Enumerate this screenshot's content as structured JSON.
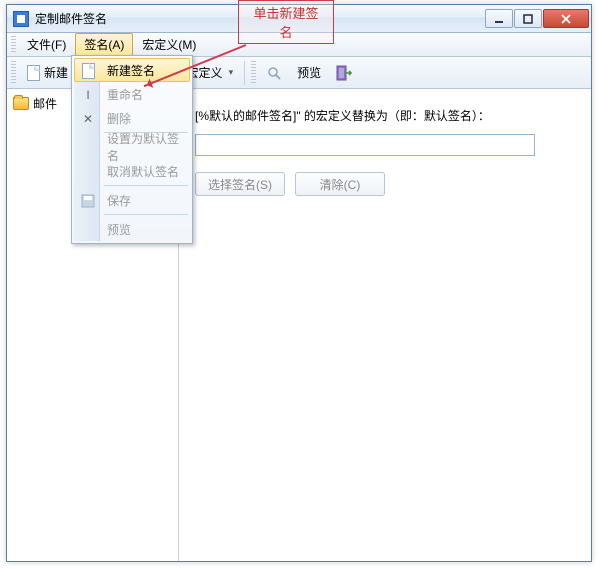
{
  "annotation": {
    "label": "单击新建签名"
  },
  "window": {
    "title": "定制邮件签名"
  },
  "menubar": {
    "file": "文件(F)",
    "sign": "签名(A)",
    "macro": "宏定义(M)"
  },
  "toolbar": {
    "new_label": "新建",
    "insert_macro": "插入宏定义",
    "preview": "预览"
  },
  "sidebar": {
    "items": [
      {
        "label": "邮件"
      }
    ]
  },
  "main": {
    "desc": "[%默认的邮件签名]\" 的宏定义替换为（即：默认签名）：",
    "input_value": "",
    "select_sign_btn": "选择签名(S)",
    "clear_btn": "清除(C)"
  },
  "dropdown": {
    "items": [
      {
        "label": "新建签名",
        "icon": "doc",
        "enabled": true,
        "hover": true
      },
      {
        "label": "重命名",
        "icon": "rename",
        "enabled": false
      },
      {
        "label": "删除",
        "icon": "delete",
        "enabled": false
      },
      {
        "sep": true
      },
      {
        "label": "设置为默认签名",
        "enabled": false
      },
      {
        "label": "取消默认签名",
        "enabled": false
      },
      {
        "sep": true
      },
      {
        "label": "保存",
        "icon": "save",
        "enabled": false
      },
      {
        "sep": true
      },
      {
        "label": "预览",
        "enabled": false
      }
    ]
  }
}
